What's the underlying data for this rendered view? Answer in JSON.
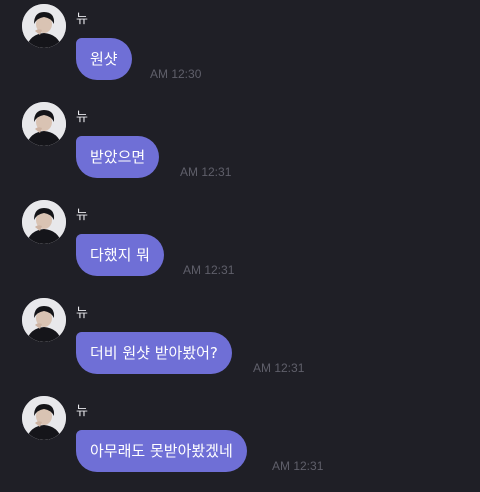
{
  "messages": [
    {
      "sender": "뉴",
      "text": "원샷",
      "time": "AM 12:30",
      "avatar_icon": "profile-photo"
    },
    {
      "sender": "뉴",
      "text": "받았으면",
      "time": "AM 12:31",
      "avatar_icon": "profile-photo"
    },
    {
      "sender": "뉴",
      "text": "다했지 뭐",
      "time": "AM 12:31",
      "avatar_icon": "profile-photo"
    },
    {
      "sender": "뉴",
      "text": "더비 원샷 받아봤어?",
      "time": "AM 12:31",
      "avatar_icon": "profile-photo"
    },
    {
      "sender": "뉴",
      "text": "아무래도 못받아봤겠네",
      "time": "AM 12:31",
      "avatar_icon": "profile-photo"
    }
  ],
  "colors": {
    "background": "#1f1f26",
    "bubble": "#6f6fd6",
    "bubble_text": "#ffffff",
    "timestamp": "#5f5f6a"
  }
}
